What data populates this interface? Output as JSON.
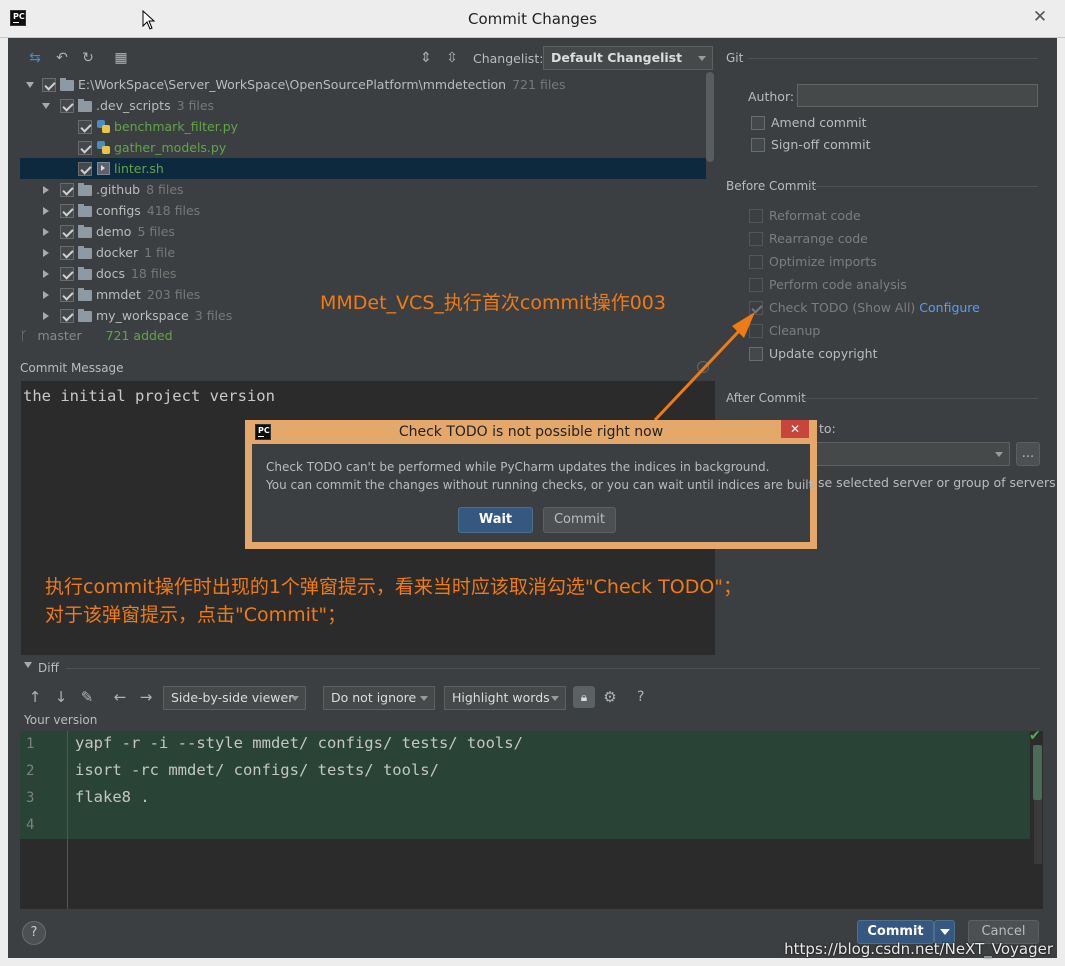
{
  "window": {
    "title": "Commit Changes",
    "close": "✕"
  },
  "toolbar": {
    "changelist_label": "Changelist:",
    "changelist_value": "Default Changelist"
  },
  "tree": [
    {
      "name": "E:\\WorkSpace\\Server_WorkSpace\\OpenSourcePlatform\\mmdetection",
      "count": "721 files"
    },
    {
      "name": ".dev_scripts",
      "count": "3 files"
    },
    {
      "name": "benchmark_filter.py",
      "count": ""
    },
    {
      "name": "gather_models.py",
      "count": ""
    },
    {
      "name": "linter.sh",
      "count": ""
    },
    {
      "name": ".github",
      "count": "8 files"
    },
    {
      "name": "configs",
      "count": "418 files"
    },
    {
      "name": "demo",
      "count": "5 files"
    },
    {
      "name": "docker",
      "count": "1 file"
    },
    {
      "name": "docs",
      "count": "18 files"
    },
    {
      "name": "mmdet",
      "count": "203 files"
    },
    {
      "name": "my_workspace",
      "count": "3 files"
    }
  ],
  "branch": {
    "name": "master",
    "added": "721 added"
  },
  "commit_message": {
    "label": "Commit Message",
    "text": "the initial project version"
  },
  "git": {
    "header": "Git",
    "author_label": "Author:",
    "author_value": "",
    "amend": "Amend commit",
    "signoff": "Sign-off commit"
  },
  "before_commit": {
    "header": "Before Commit",
    "options": [
      "Reformat code",
      "Rearrange code",
      "Optimize imports",
      "Perform code analysis",
      "Check TODO (Show All)",
      "Cleanup",
      "Update copyright"
    ],
    "configure": "Configure"
  },
  "after_commit": {
    "header": "After Commit",
    "upload_to": "to:",
    "servers_hint": "se selected server or group of servers",
    "more": "..."
  },
  "diff": {
    "header": "Diff",
    "viewer": "Side-by-side viewer",
    "ignore": "Do not ignore",
    "highlight": "Highlight words",
    "your_version": "Your version",
    "help": "?",
    "lines": [
      {
        "num": "1",
        "code": "yapf -r -i --style mmdet/ configs/ tests/ tools/"
      },
      {
        "num": "2",
        "code": "isort -rc mmdet/ configs/ tests/ tools/"
      },
      {
        "num": "3",
        "code": "flake8 ."
      },
      {
        "num": "4",
        "code": ""
      }
    ]
  },
  "buttons": {
    "commit": "Commit",
    "cancel": "Cancel",
    "help": "?"
  },
  "modal": {
    "title": "Check TODO is not possible right now",
    "line1": "Check TODO can't be performed while PyCharm updates the indices in background.",
    "line2": "You can commit the changes without running checks, or you can wait until indices are built.",
    "wait": "Wait",
    "commit": "Commit"
  },
  "annotations": {
    "title": "MMDet_VCS_执行首次commit操作003",
    "note1": "执行commit操作时出现的1个弹窗提示，看来当时应该取消勾选\"Check TODO\"；",
    "note2": "对于该弹窗提示，点击\"Commit\"；",
    "watermark": "https://blog.csdn.net/NeXT_Voyager"
  },
  "colors": {
    "accent": "#365880",
    "annotation": "#f07a14",
    "added": "#62a34a",
    "diff_bg": "#294436"
  }
}
